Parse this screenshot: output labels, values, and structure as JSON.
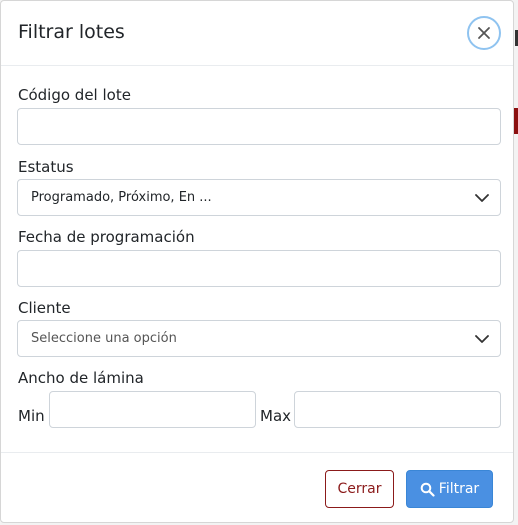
{
  "modal": {
    "title": "Filtrar lotes",
    "close_icon": "close-icon"
  },
  "fields": {
    "codigo": {
      "label": "Código del lote",
      "value": "",
      "placeholder": ""
    },
    "estatus": {
      "label": "Estatus",
      "selected": "Programado, Próximo, En ...",
      "icon": "chevron-down-icon"
    },
    "fecha": {
      "label": "Fecha de programación",
      "value": "",
      "placeholder": ""
    },
    "cliente": {
      "label": "Cliente",
      "selected": "Seleccione una opción",
      "icon": "chevron-down-icon"
    },
    "ancho": {
      "label": "Ancho de lámina",
      "min_label": "Min",
      "max_label": "Max",
      "min_value": "",
      "max_value": ""
    }
  },
  "footer": {
    "close_label": "Cerrar",
    "filter_label": "Filtrar",
    "filter_icon": "search-icon"
  },
  "colors": {
    "primary": "#4a90e2",
    "danger_outline": "#8b1a1a",
    "close_ring": "#8fc3f0"
  }
}
